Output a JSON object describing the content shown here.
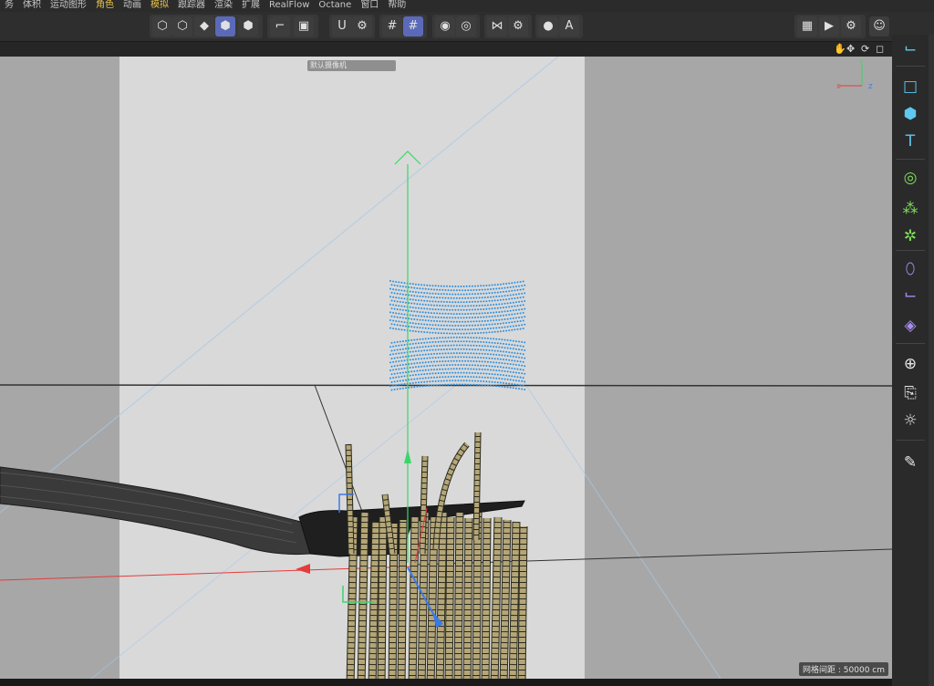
{
  "menu": {
    "items": [
      {
        "label": "务",
        "active": false
      },
      {
        "label": "体积",
        "active": false
      },
      {
        "label": "运动图形",
        "active": false
      },
      {
        "label": "角色",
        "active": true
      },
      {
        "label": "动画",
        "active": false
      },
      {
        "label": "模拟",
        "active": true
      },
      {
        "label": "跟踪器",
        "active": false
      },
      {
        "label": "渲染",
        "active": false
      },
      {
        "label": "扩展",
        "active": false
      },
      {
        "label": "RealFlow",
        "active": false
      },
      {
        "label": "Octane",
        "active": false
      },
      {
        "label": "窗口",
        "active": false
      },
      {
        "label": "帮助",
        "active": false
      }
    ]
  },
  "toolbar": {
    "buttons": [
      {
        "icon": "points-mode-icon",
        "glyph": "⬡"
      },
      {
        "icon": "edges-mode-icon",
        "glyph": "⬡"
      },
      {
        "icon": "polygons-mode-icon",
        "glyph": "◆"
      },
      {
        "icon": "model-mode-icon",
        "glyph": "⬢",
        "selected": true
      },
      {
        "icon": "texture-mode-icon",
        "glyph": "⬢"
      },
      {
        "icon": "axis-mode-icon",
        "glyph": "⌐"
      },
      {
        "icon": "viewport-solo-icon",
        "glyph": "▣"
      },
      {
        "icon": "snap-icon",
        "glyph": "U"
      },
      {
        "icon": "snap-settings-icon",
        "glyph": "⚙"
      },
      {
        "icon": "workplane-icon",
        "glyph": "#"
      },
      {
        "icon": "grid-snap-icon",
        "glyph": "#",
        "selected": true
      },
      {
        "icon": "record-icon",
        "glyph": "◉"
      },
      {
        "icon": "autokey-icon",
        "glyph": "◎"
      },
      {
        "icon": "symmetry-icon",
        "glyph": "⋈"
      },
      {
        "icon": "symmetry-settings-icon",
        "glyph": "⚙"
      },
      {
        "icon": "octane-icon",
        "glyph": "●"
      },
      {
        "icon": "octane-a-icon",
        "glyph": "A"
      },
      {
        "icon": "render-view-icon",
        "glyph": "▦"
      },
      {
        "icon": "render-picture-viewer-icon",
        "glyph": "▶"
      },
      {
        "icon": "render-settings-icon",
        "glyph": "⚙"
      },
      {
        "icon": "user-account-icon",
        "glyph": "☺"
      }
    ]
  },
  "viewport": {
    "camera_label": "默认摄像机",
    "grid_distance": "网格间距 : 50000 cm",
    "panel_fragment": "",
    "axis": {
      "x": "X",
      "y": "Y",
      "z": "Z"
    },
    "colors": {
      "background": "#a7a7a7",
      "safe_frame": "#d9d9d9",
      "particles": "#2f8fdc",
      "noodles": "#b4a678",
      "x_axis": "#e63b3b",
      "y_axis": "#3bd66a",
      "z_axis": "#3b7ae6"
    }
  },
  "side_panel": {
    "icons": [
      "null-object-icon",
      "cube-outline-icon",
      "cube-icon",
      "text-icon",
      "cloner-icon",
      "mograph-matrix-icon",
      "gear-effector-icon",
      "deformer-icon",
      "spline-icon",
      "field-icon",
      "environment-icon",
      "camera-icon",
      "light-icon",
      "edit-icon"
    ]
  }
}
